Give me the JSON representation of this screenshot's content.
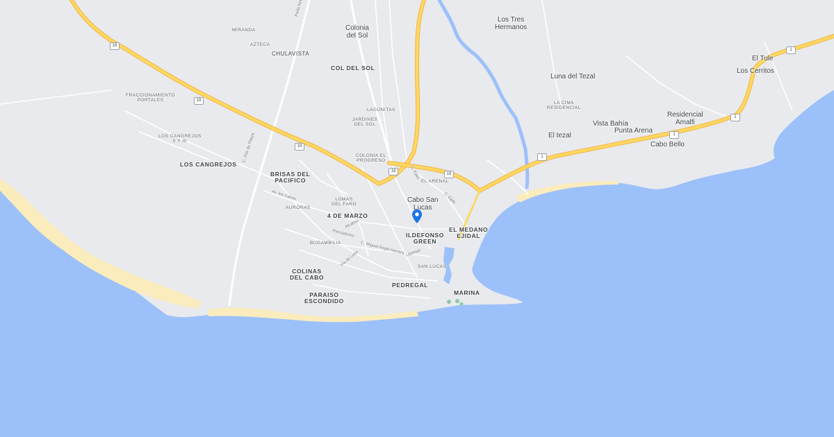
{
  "map": {
    "place_labels": {
      "cabo_san_lucas": "Cabo San\nLucas",
      "los_tres_hermanos": "Los Tres\nHermanos",
      "colonia_del_sol": "Colonia\ndel Sol",
      "luna_del_tezal": "Luna del Tezal",
      "el_tule": "El Tule",
      "los_cerritos": "Los Cerritos",
      "residencial_amalfi": "Residencial\nAmalfi",
      "vista_bahia": "Vista Bahía",
      "punta_arena": "Punta Arena",
      "cabo_bello": "Cabo Bello",
      "el_tezal": "El tezal"
    },
    "neighborhood_labels": {
      "miranda": "MIRANDA",
      "azteca": "AZTECA",
      "chulavista": "CHULAVISTA",
      "col_del_sol": "COL DEL SOL",
      "fraccionamiento_portales": "FRACCIONAMIENTO\nPORTALES",
      "lagunitas": "LAGUNITAS",
      "jardines_del_sol": "JARDINES\nDEL SOL",
      "la_cima_residencial": "LA CIMA\nRESIDENCIAL",
      "los_cangrejos_ii_y_iii": "LOS CANGREJOS\nII Y III",
      "colonia_el_progreso": "COLONIA EL\nPROGRESO",
      "los_cangrejos": "LOS CANGREJOS",
      "brisas_del_pacifico": "BRISAS DEL\nPACIFICO",
      "el_arenal": "EL ARENAL",
      "lomas_del_faro": "LOMAS\nDEL FARO",
      "auroras": "AURORAS",
      "cuatro_de_marzo": "4 DE MARZO",
      "el_medano_ejidal": "EL MEDANO\nEJIDAL",
      "ildefonso_green": "ILDEFONSO\nGREEN",
      "bugambilia": "BUGAMBILIA",
      "san_lucas": "SAN LUCAS",
      "colinas_del_cabo": "COLINAS\nDEL CABO",
      "pedregal": "PEDREGAL",
      "marina": "MARINA",
      "paraiso_escondido": "PARAISO\nESCONDIDO"
    },
    "street_labels": {
      "c_ejido": "C. Ejido",
      "c_ejido_2": "C. Ejido",
      "av_los_cabos": "Av. los Cabos",
      "alcatraz": "Alcatraz",
      "pescadores": "Pescadores",
      "c_miguel_angel_herrera": "C. Miguel Ángel Herrera",
      "libertad": "Libertad",
      "via_de_leon": "Vía de León",
      "c_flor_de_pitaya": "C. Flor de Pitaya",
      "perla_norte": "Perla Norte"
    },
    "route_shields": [
      "19",
      "19",
      "19",
      "19",
      "19",
      "1",
      "1",
      "1",
      "1"
    ],
    "colors": {
      "water": "#9cc0f9",
      "land": "#e8eaed",
      "highway": "#fdd863",
      "highway_casing": "#f3b23d",
      "road": "#ffffff",
      "river": "#9cc0f9",
      "beach": "#fbecbd",
      "pin": "#1a73e8"
    }
  }
}
